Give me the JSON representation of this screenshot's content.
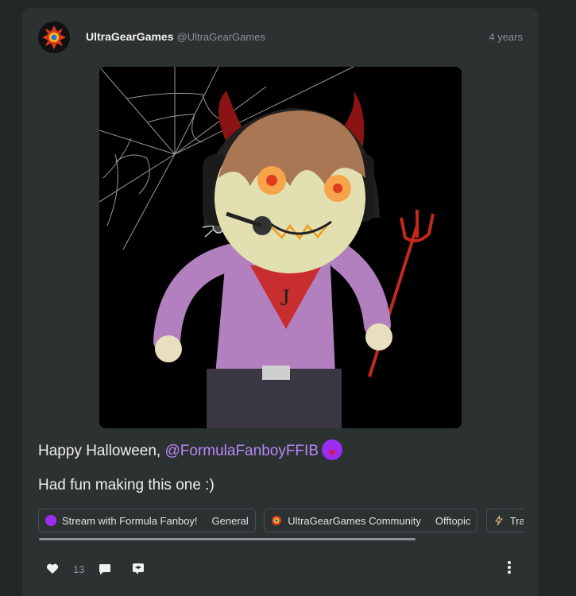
{
  "post": {
    "author": {
      "display_name": "UltraGearGames",
      "handle": "@UltraGearGames",
      "avatar": "ultragear-logo-icon"
    },
    "timestamp": "4 years",
    "media": {
      "description_icon": "halloween-devil-character-image"
    },
    "text": {
      "prefix": "Happy Halloween, ",
      "mention": "@FormulaFanboyFFIB",
      "line2": "Had fun making this one :)"
    },
    "chips": [
      {
        "icon": "purple-circle-icon",
        "label": "Stream with Formula Fanboy!",
        "channel": "General"
      },
      {
        "icon": "ultragear-logo-icon",
        "label": "UltraGearGames Community",
        "channel": "Offtopic"
      },
      {
        "icon": "lightning-icon",
        "label": "Trash",
        "channel": ""
      }
    ],
    "actions": {
      "like_count": "13"
    }
  },
  "colors": {
    "background": "#232728",
    "card": "#2c3132",
    "mention": "#b887f5",
    "badge": "#9b2cf0"
  }
}
